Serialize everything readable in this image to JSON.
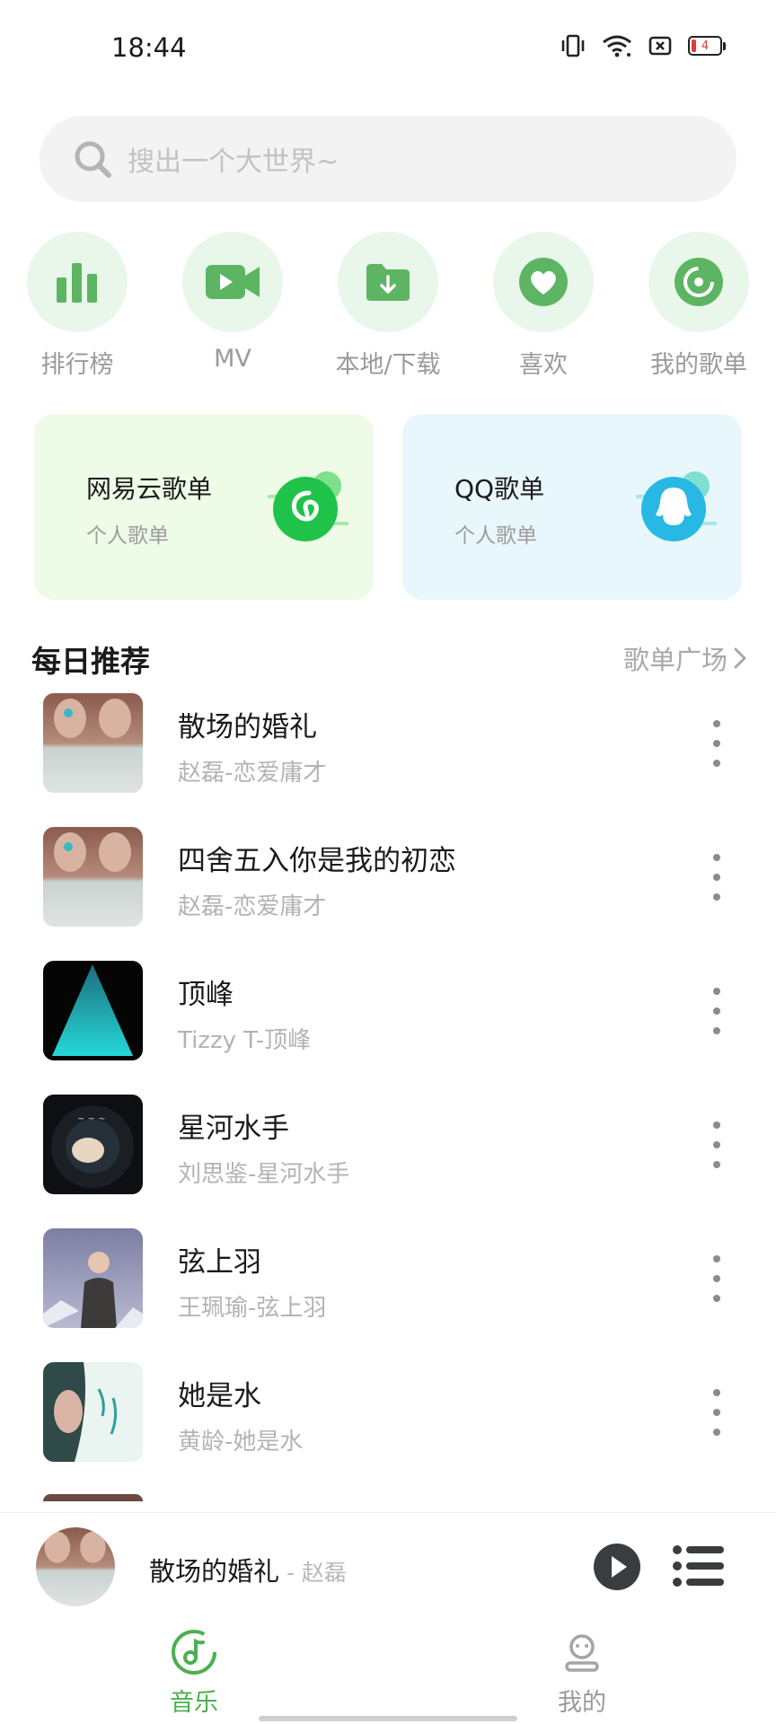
{
  "status_bar": {
    "time": "18:44",
    "battery_level": "4",
    "icons": [
      "vibrate-icon",
      "wifi-icon",
      "no-sim-icon",
      "battery-icon"
    ]
  },
  "search": {
    "placeholder": "搜出一个大世界~"
  },
  "quick_nav": [
    {
      "label": "排行榜",
      "icon": "chart-icon"
    },
    {
      "label": "MV",
      "icon": "video-icon"
    },
    {
      "label": "本地/下载",
      "icon": "download-folder-icon"
    },
    {
      "label": "喜欢",
      "icon": "heart-icon"
    },
    {
      "label": "我的歌单",
      "icon": "playlist-disc-icon"
    }
  ],
  "playlist_cards": [
    {
      "title": "网易云歌单",
      "subtitle": "个人歌单",
      "icon": "netease-logo",
      "color": "#20c34a"
    },
    {
      "title": "QQ歌单",
      "subtitle": "个人歌单",
      "icon": "qq-logo",
      "color": "#27b8e4"
    }
  ],
  "daily": {
    "title": "每日推荐",
    "link_label": "歌单广场",
    "songs": [
      {
        "title": "散场的婚礼",
        "meta": "赵磊-恋爱庸才"
      },
      {
        "title": "四舍五入你是我的初恋",
        "meta": "赵磊-恋爱庸才"
      },
      {
        "title": "顶峰",
        "meta": "Tizzy T-顶峰"
      },
      {
        "title": "星河水手",
        "meta": "刘思鉴-星河水手"
      },
      {
        "title": "弦上羽",
        "meta": "王珮瑜-弦上羽"
      },
      {
        "title": "她是水",
        "meta": "黄龄-她是水"
      }
    ]
  },
  "mini_player": {
    "title": "散场的婚礼",
    "artist": " - 赵磊"
  },
  "tabs": [
    {
      "label": "音乐",
      "icon": "music-note-icon",
      "active": true
    },
    {
      "label": "我的",
      "icon": "profile-icon",
      "active": false
    }
  ],
  "colors": {
    "accent": "#4caf50",
    "inactive": "#9a9a9a"
  }
}
